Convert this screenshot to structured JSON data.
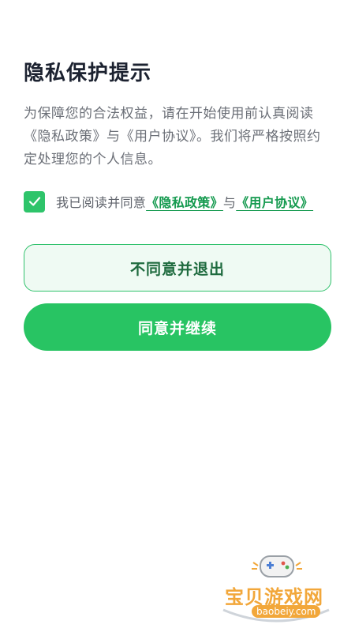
{
  "dialog": {
    "title": "隐私保护提示",
    "description": "为保障您的合法权益，请在开始使用前认真阅读《隐私政策》与《用户协议》。我们将严格按照约定处理您的个人信息。",
    "agree_prefix": "我已阅读并同意",
    "privacy_link": "《隐私政策》",
    "and_text": "与",
    "terms_link": "《用户协议》",
    "checkbox_checked": true
  },
  "buttons": {
    "decline_label": "不同意并退出",
    "accept_label": "同意并继续"
  },
  "watermark": {
    "text": "宝贝游戏网",
    "url": "baobeiy.com"
  },
  "colors": {
    "accent": "#28c463",
    "link": "#159a4f",
    "decline_bg": "#effaf3"
  },
  "icons": {
    "checkbox": "checkmark-icon",
    "watermark": "gamepad-icon"
  }
}
